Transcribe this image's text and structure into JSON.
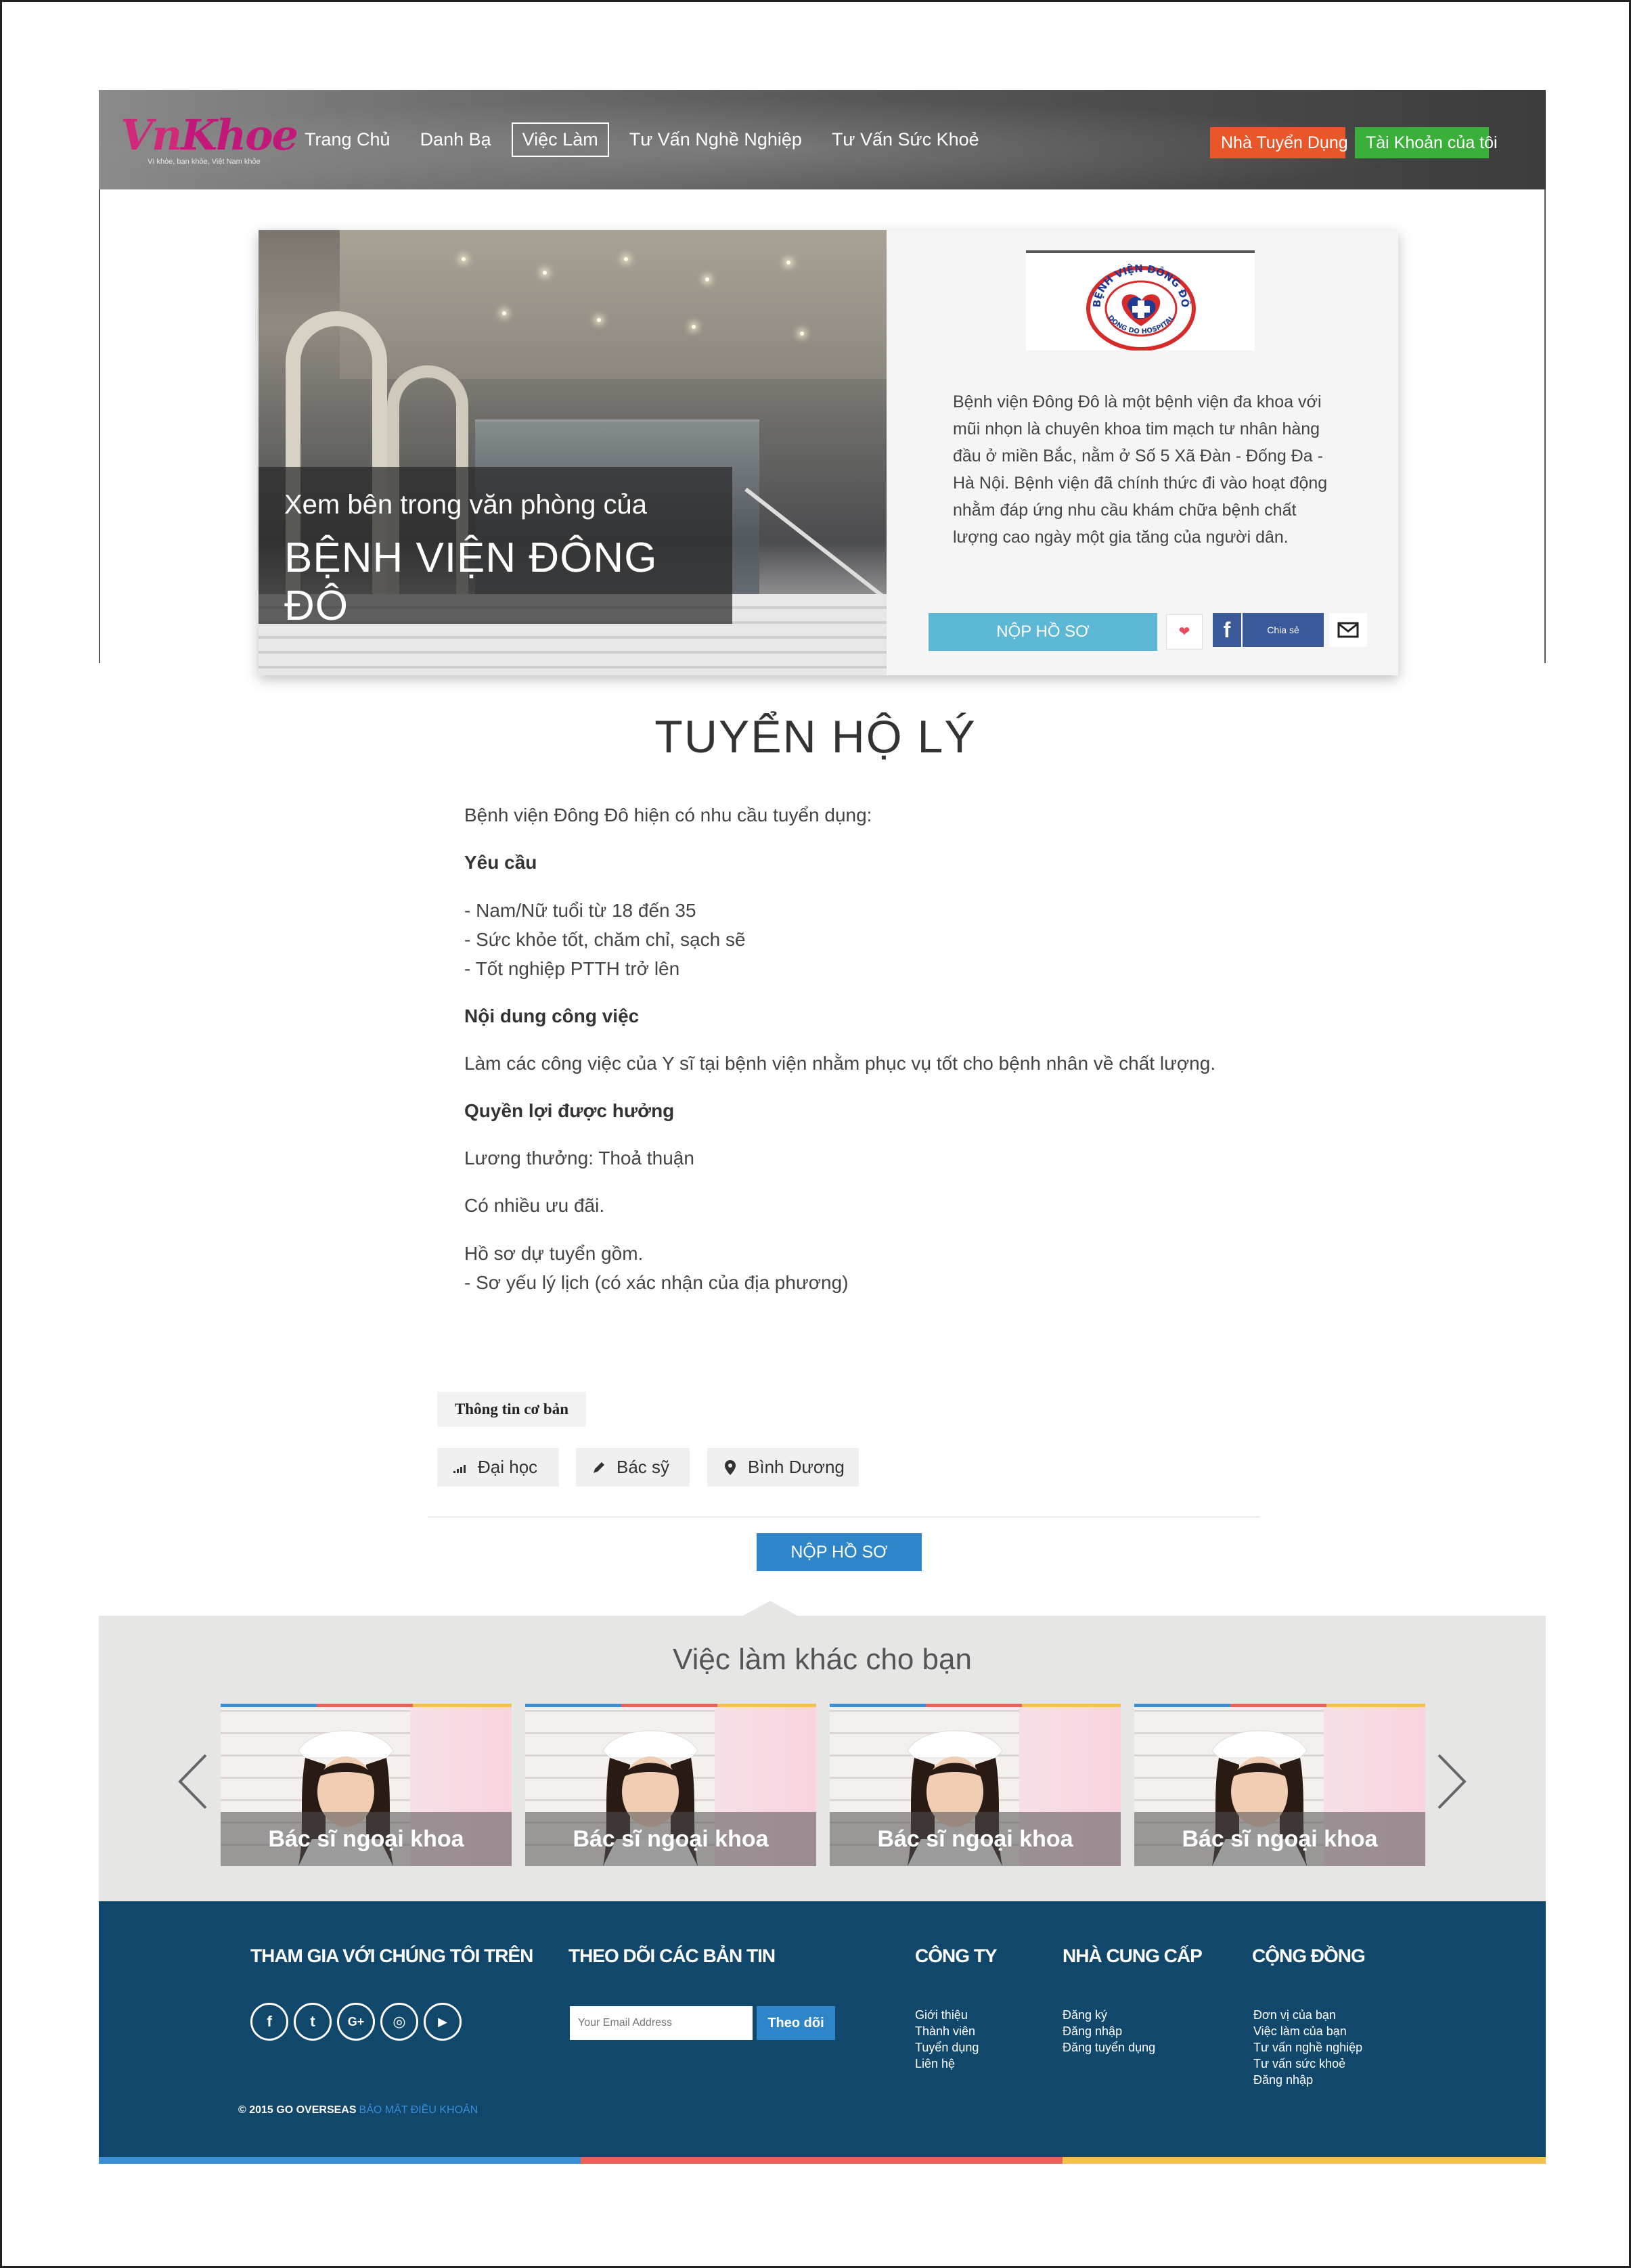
{
  "header": {
    "logo_text_a": "Vn",
    "logo_text_b": "Khoe",
    "logo_tagline": "Vì khỏe, bạn khỏe, Việt Nam khỏe",
    "nav": [
      {
        "label": "Trang Chủ"
      },
      {
        "label": "Danh Bạ"
      },
      {
        "label": "Việc Làm",
        "active": true
      },
      {
        "label": "Tư Vấn Nghề Nghiệp"
      },
      {
        "label": "Tư Vấn Sức Khoẻ"
      }
    ],
    "employer_button": "Nhà Tuyển Dụng",
    "account_button": "Tài Khoản của tôi",
    "colors": {
      "employer": "#e8562a",
      "account": "#3ab03a"
    }
  },
  "hero": {
    "caption_line1": "Xem bên trong văn phòng của",
    "caption_line2": "BỆNH VIỆN ĐÔNG ĐÔ",
    "logo_ring_text": "BỆNH VIỆN ĐÔNG ĐÔ",
    "logo_sub_text": "DONG DO HOSPITAL",
    "description": "Bệnh viện Đông Đô là một bệnh viện đa khoa với mũi nhọn là chuyên khoa tim mạch tư nhân hàng đầu ở miền Bắc, nằm ở Số 5 Xã Đàn - Đống Đa - Hà Nội. Bệnh viện đã chính thức đi vào hoạt động nhằm đáp ứng nhu cầu khám chữa bệnh chất lượng cao ngày một gia tăng của người dân.",
    "apply_label": "NỘP HỒ SƠ",
    "heart_icon": "heart-icon",
    "facebook_icon": "f",
    "share_label": "Chia sẻ",
    "mail_icon": "envelope-icon"
  },
  "job": {
    "title": "TUYỂN HỘ LÝ",
    "intro": "Bệnh viện Đông Đô hiện có nhu cầu tuyển dụng:",
    "requirements_heading": "Yêu cầu",
    "requirements": [
      "- Nam/Nữ tuổi từ 18 đến 35",
      "- Sức khỏe tốt, chăm chỉ, sạch sẽ",
      "- Tốt nghiệp PTTH trở lên"
    ],
    "content_heading": "Nội dung công việc",
    "content": "Làm các công việc của Y sĩ tại bệnh viện nhằm phục vụ tốt cho bệnh nhân về chất lượng.",
    "benefits_heading": "Quyền lợi được hưởng",
    "salary": "Lương thưởng: Thoả thuận",
    "perks": "Có nhiều ưu đãi.",
    "docs_line1": "Hồ sơ dự tuyển gồm.",
    "docs_line2": "- Sơ yếu lý lịch (có xác nhận của địa phương)",
    "basic_info_tab": "Thông tin cơ bản",
    "tags": [
      {
        "icon": "signal-icon",
        "label": "Đại học"
      },
      {
        "icon": "pencil-icon",
        "label": "Bác sỹ"
      },
      {
        "icon": "map-marker-icon",
        "label": "Bình Dương"
      }
    ],
    "apply_label": "NỘP HỒ SƠ"
  },
  "other_jobs": {
    "title": "Việc làm khác cho bạn",
    "cards": [
      {
        "label": "Bác sĩ ngoại khoa"
      },
      {
        "label": "Bác sĩ ngoại khoa"
      },
      {
        "label": "Bác sĩ ngoại khoa"
      },
      {
        "label": "Bác sĩ ngoại khoa"
      }
    ]
  },
  "footer": {
    "join_heading": "THAM GIA VỚI CHÚNG TÔI TRÊN",
    "social": [
      {
        "icon": "facebook-icon",
        "glyph": "f"
      },
      {
        "icon": "twitter-icon",
        "glyph": "t"
      },
      {
        "icon": "google-plus-icon",
        "glyph": "G+"
      },
      {
        "icon": "instagram-icon",
        "glyph": "◎"
      },
      {
        "icon": "youtube-icon",
        "glyph": "▶"
      }
    ],
    "newsletter_heading": "THEO DÕI CÁC BẢN TIN",
    "email_placeholder": "Your Email Address",
    "follow_label": "Theo dõi",
    "company_heading": "CÔNG TY",
    "company_links": [
      "Giới thiệu",
      "Thành viên",
      "Tuyển dụng",
      "Liên hệ"
    ],
    "provider_heading": "NHÀ CUNG CẤP",
    "provider_links": [
      "Đăng ký",
      "Đăng nhập",
      "Đăng tuyển dụng"
    ],
    "community_heading": "CỘNG ĐỒNG",
    "community_links": [
      "Đơn vị của bạn",
      "Việc làm của bạn",
      "Tư vấn nghề nghiệp",
      "Tư vấn sức khoẻ",
      "Đăng nhập"
    ],
    "copyright": "© 2015 GO OVERSEAS",
    "terms": "BẢO MẬT ĐIỀU KHOẢN"
  }
}
